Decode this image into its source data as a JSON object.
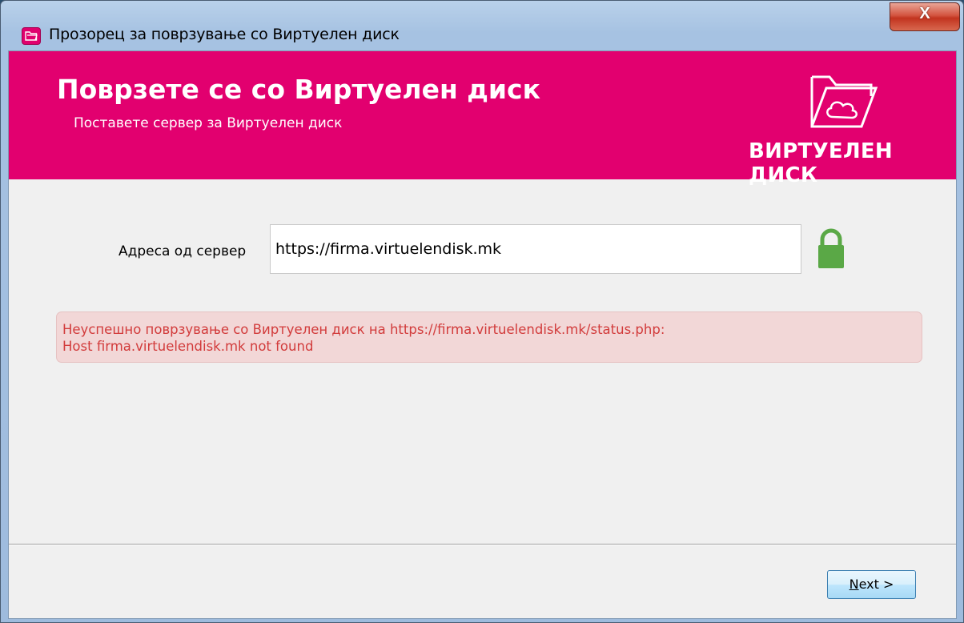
{
  "window": {
    "title": "Прозорец за поврзување со Виртуелен диск",
    "close_label": "X"
  },
  "banner": {
    "title": "Поврзете се со Виртуелен диск",
    "subtitle": "Поставете сервер за Виртуелен диск",
    "logo_text": "ВИРТУЕЛЕН ДИСК",
    "color": "#e2006f"
  },
  "server": {
    "label": "Адреса од сервер",
    "value": "https://firma.virtuelendisk.mk",
    "secure_icon": "lock-icon",
    "secure_color": "#5aa846"
  },
  "error": {
    "line1": "Неуспешно поврзување со Виртуелен диск на https://firma.virtuelendisk.mk/status.php:",
    "line2": "Host firma.virtuelendisk.mk not found",
    "text_color": "#d23b3b",
    "background": "#f2d7d7"
  },
  "footer": {
    "next_mnemonic": "N",
    "next_rest": "ext >"
  }
}
